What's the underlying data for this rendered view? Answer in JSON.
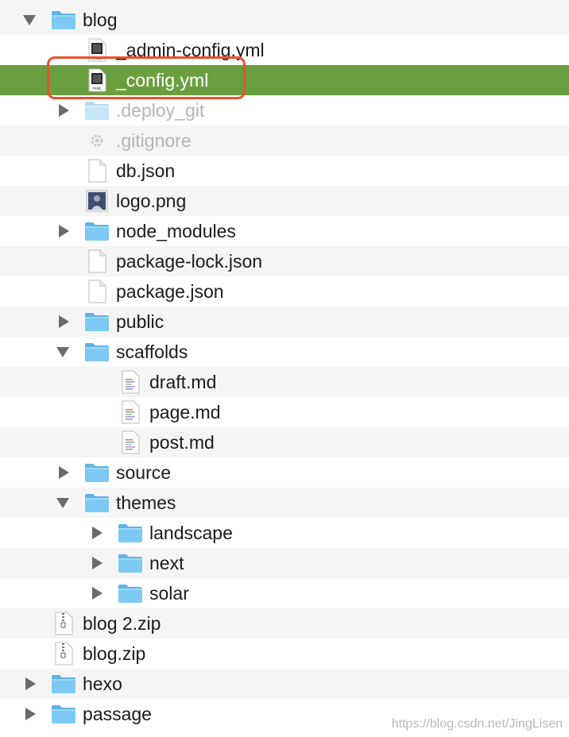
{
  "tree": {
    "items": [
      {
        "label": "blog",
        "type": "folder",
        "expanded": true,
        "depth": 0
      },
      {
        "label": "_admin-config.yml",
        "type": "yaml",
        "depth": 1
      },
      {
        "label": "_config.yml",
        "type": "yaml",
        "depth": 1,
        "selected": true,
        "highlighted": true
      },
      {
        "label": ".deploy_git",
        "type": "folder",
        "expanded": false,
        "depth": 1,
        "hidden_file": true
      },
      {
        "label": ".gitignore",
        "type": "config",
        "depth": 1,
        "hidden_file": true
      },
      {
        "label": "db.json",
        "type": "file",
        "depth": 1
      },
      {
        "label": "logo.png",
        "type": "image",
        "depth": 1
      },
      {
        "label": "node_modules",
        "type": "folder",
        "expanded": false,
        "depth": 1
      },
      {
        "label": "package-lock.json",
        "type": "file",
        "depth": 1
      },
      {
        "label": "package.json",
        "type": "file",
        "depth": 1
      },
      {
        "label": "public",
        "type": "folder",
        "expanded": false,
        "depth": 1
      },
      {
        "label": "scaffolds",
        "type": "folder",
        "expanded": true,
        "depth": 1
      },
      {
        "label": "draft.md",
        "type": "markdown",
        "depth": 2
      },
      {
        "label": "page.md",
        "type": "markdown",
        "depth": 2
      },
      {
        "label": "post.md",
        "type": "markdown",
        "depth": 2
      },
      {
        "label": "source",
        "type": "folder",
        "expanded": false,
        "depth": 1
      },
      {
        "label": "themes",
        "type": "folder",
        "expanded": true,
        "depth": 1
      },
      {
        "label": "landscape",
        "type": "folder",
        "expanded": false,
        "depth": 2
      },
      {
        "label": "next",
        "type": "folder",
        "expanded": false,
        "depth": 2
      },
      {
        "label": "solar",
        "type": "folder",
        "expanded": false,
        "depth": 2
      },
      {
        "label": "blog 2.zip",
        "type": "zip",
        "depth": 0
      },
      {
        "label": "blog.zip",
        "type": "zip",
        "depth": 0
      },
      {
        "label": "hexo",
        "type": "folder",
        "expanded": false,
        "depth": 0
      },
      {
        "label": "passage",
        "type": "folder",
        "expanded": false,
        "depth": 0
      }
    ]
  },
  "watermark": "https://blog.csdn.net/JingLisen",
  "colors": {
    "selection": "#6a9f3f",
    "highlight_box": "#e8512c",
    "folder": "#6cc0f0",
    "row_alt": "#f5f5f5"
  }
}
